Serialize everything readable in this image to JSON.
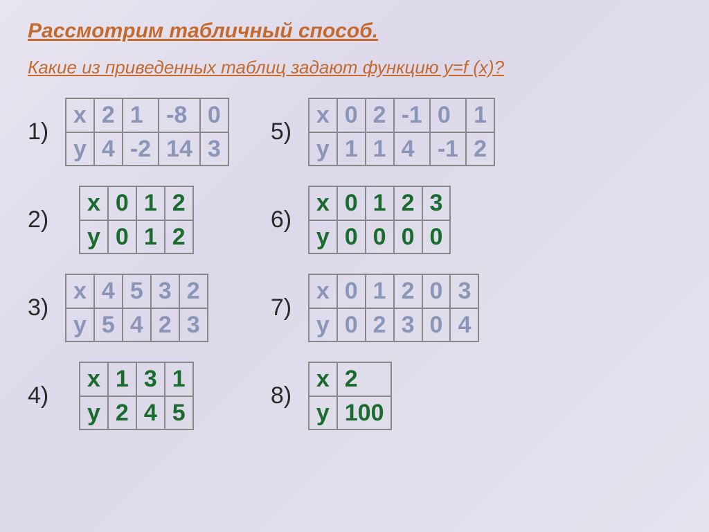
{
  "title": "Рассмотрим табличный способ.",
  "subtitle": "Какие из приведенных таблиц задают функцию y=f (x)?",
  "labels": [
    "1)",
    "2)",
    "3)",
    "4)",
    "5)",
    "6)",
    "7)",
    "8)"
  ],
  "t1": {
    "x": [
      "x",
      "2",
      "1",
      "-8",
      "0"
    ],
    "y": [
      "y",
      "4",
      "-2",
      "14",
      "3"
    ]
  },
  "t2": {
    "x": [
      "x",
      "0",
      "1",
      "2"
    ],
    "y": [
      "y",
      "0",
      "1",
      "2"
    ]
  },
  "t3": {
    "x": [
      "x",
      "4",
      "5",
      "3",
      "2"
    ],
    "y": [
      "y",
      "5",
      "4",
      "2",
      "3"
    ]
  },
  "t4": {
    "x": [
      "x",
      "1",
      "3",
      "1"
    ],
    "y": [
      "y",
      "2",
      "4",
      "5"
    ]
  },
  "t5": {
    "x": [
      "x",
      "0",
      "2",
      "-1",
      "0",
      "1"
    ],
    "y": [
      "y",
      "1",
      "1",
      "4",
      "-1",
      "2"
    ]
  },
  "t6": {
    "x": [
      "x",
      "0",
      "1",
      "2",
      "3"
    ],
    "y": [
      "y",
      "0",
      "0",
      "0",
      "0"
    ]
  },
  "t7": {
    "x": [
      "x",
      "0",
      "1",
      "2",
      "0",
      "3"
    ],
    "y": [
      "y",
      "0",
      "2",
      "3",
      "0",
      "4"
    ]
  },
  "t8": {
    "x": [
      "x",
      "2"
    ],
    "y": [
      "y",
      "100"
    ]
  }
}
